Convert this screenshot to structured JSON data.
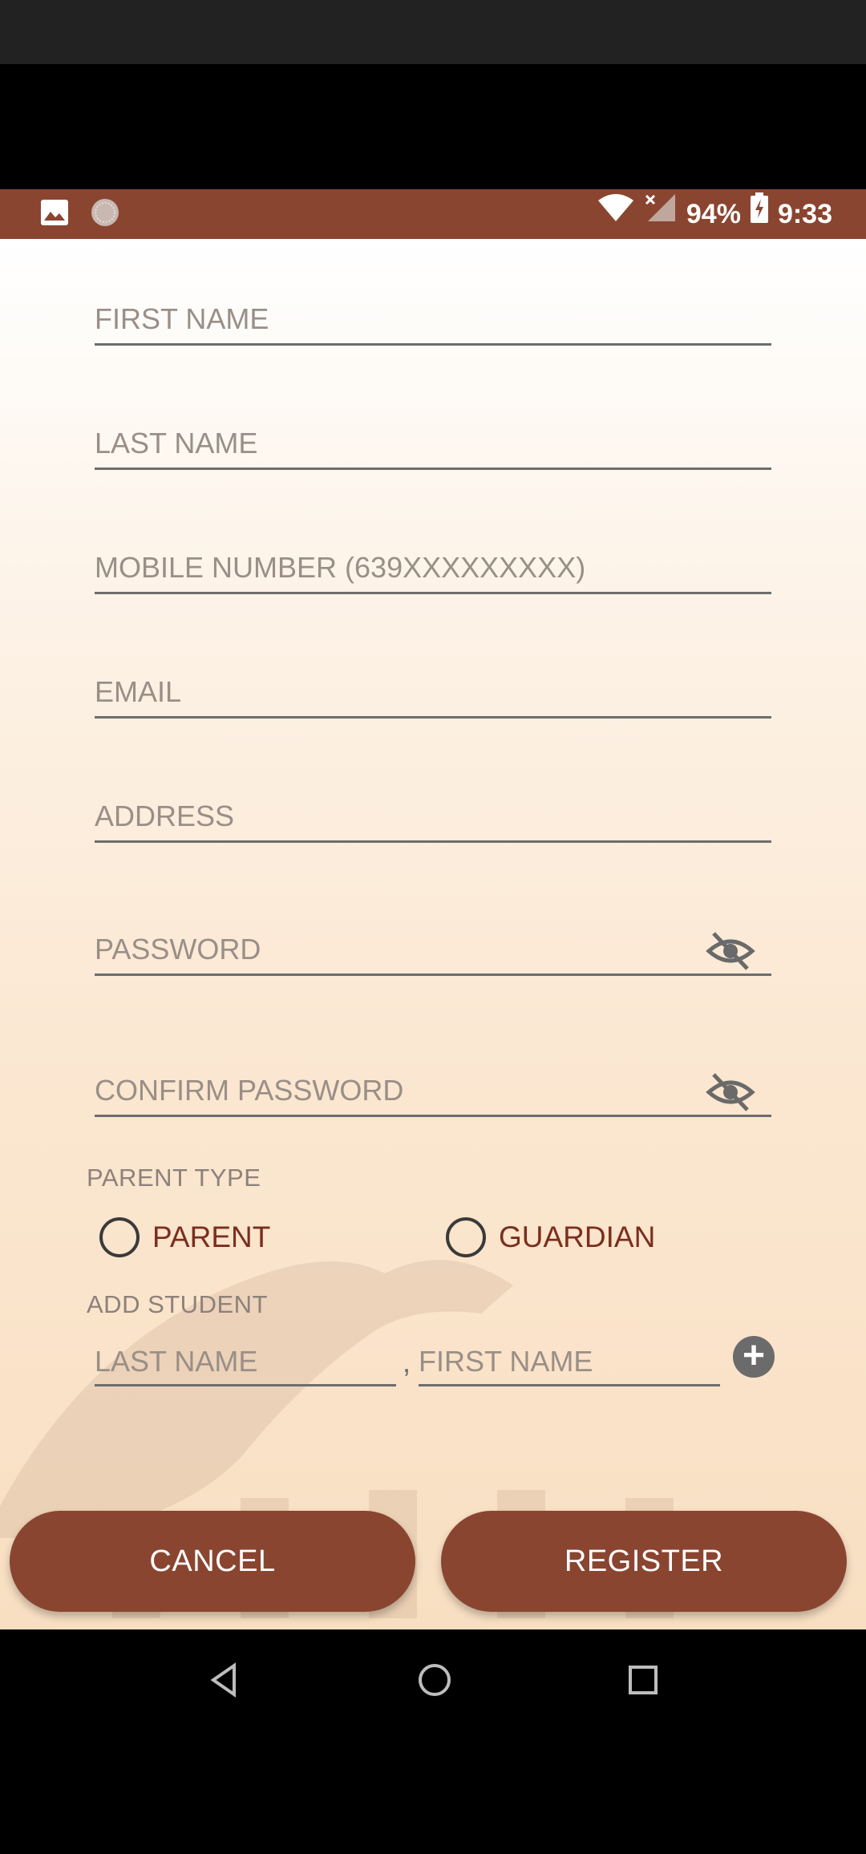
{
  "status_bar": {
    "battery": "94%",
    "time": "9:33"
  },
  "form": {
    "first_name_placeholder": "FIRST NAME",
    "last_name_placeholder": "LAST NAME",
    "mobile_placeholder": "MOBILE NUMBER (639XXXXXXXXX)",
    "email_placeholder": "EMAIL",
    "address_placeholder": "ADDRESS",
    "password_placeholder": "PASSWORD",
    "confirm_password_placeholder": "CONFIRM PASSWORD"
  },
  "parent_type": {
    "label": "PARENT TYPE",
    "options": [
      "PARENT",
      "GUARDIAN"
    ]
  },
  "add_student": {
    "label": "ADD STUDENT",
    "last_name_placeholder": "LAST NAME",
    "separator": ",",
    "first_name_placeholder": "FIRST NAME",
    "add_icon": "+"
  },
  "buttons": {
    "cancel": "CANCEL",
    "register": "REGISTER"
  },
  "colors": {
    "accent": "#8a4530",
    "radio_label": "#7a2e1e"
  },
  "icons": [
    "image-icon",
    "notification-dot-icon",
    "wifi-icon",
    "signal-icon",
    "battery-icon",
    "eye-off-icon",
    "add-circle-icon",
    "back-icon",
    "home-icon",
    "recents-icon"
  ]
}
